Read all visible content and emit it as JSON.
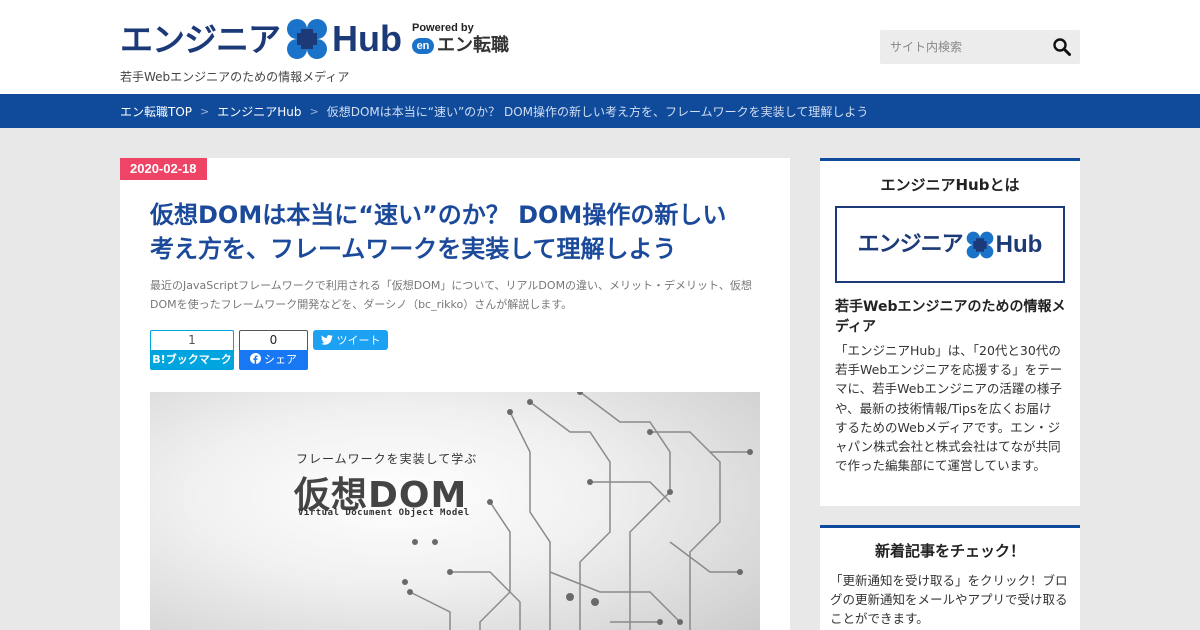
{
  "header": {
    "logo_text": "エンジニア",
    "logo_hub": "Hub",
    "powered_by": "Powered by",
    "powered_en": "en",
    "powered_name": "エン転職",
    "tagline": "若手Webエンジニアのための情報メディア",
    "search_placeholder": "サイト内検索"
  },
  "breadcrumb": {
    "items": [
      "エン転職TOP",
      "エンジニアHub"
    ],
    "separator": ">",
    "current": "仮想DOMは本当に“速い”のか？ DOM操作の新しい考え方を、フレームワークを実装して理解しよう"
  },
  "article": {
    "date": "2020-02-18",
    "title_line1": "仮想DOMは本当に“速い”のか？ DOM操作の新しい",
    "title_line2": "考え方を、フレームワークを実装して理解しよう",
    "lead_line1": "最近のJavaScriptフレームワークで利用される「仮想DOM」について、リアルDOMの違い、メリット・デメリット、仮想",
    "lead_line2": "DOMを使ったフレームワーク開発などを、ダーシノ（bc_rikko）さんが解説します。",
    "share": {
      "hatena_count": "1",
      "hatena_label": "ブックマーク",
      "hatena_icon": "B!",
      "fb_count": "0",
      "fb_label": "シェア",
      "tweet_label": "ツイート"
    },
    "hero": {
      "kicker": "フレームワークを実装して学ぶ",
      "title": "仮想DOM",
      "subtitle": "Virtual Document Object Model"
    }
  },
  "sidebar": {
    "about": {
      "title": "エンジニアHubとは",
      "logo_text": "エンジニア",
      "logo_hub": "Hub",
      "subtitle": "若手Webエンジニアのための情報メディア",
      "body": "「エンジニアHub」は、「20代と30代の若手Webエンジニアを応援する」をテーマに、若手Webエンジニアの活躍の様子や、最新の技術情報/Tipsを広くお届けするためのWebメディアです。エン・ジャパン株式会社と株式会社はてなが共同で作った編集部にて運営しています。"
    },
    "updates": {
      "title": "新着記事をチェック！",
      "body": "「更新通知を受け取る」をクリック！ブログの更新通知をメールやアプリで受け取ることができます。"
    }
  },
  "colors": {
    "brand_navy": "#1c3a78",
    "brand_blue": "#1a73c8",
    "nav_bar": "#0f4a9b",
    "date_badge": "#ef4466",
    "title": "#1c4a9b",
    "hatena": "#00a4de",
    "facebook": "#1877f2",
    "twitter": "#1da1f2"
  },
  "icons": {
    "logo": "four-circle-hub-mark",
    "search": "magnifier-icon",
    "twitter": "twitter-bird-icon",
    "facebook": "facebook-f-icon"
  }
}
